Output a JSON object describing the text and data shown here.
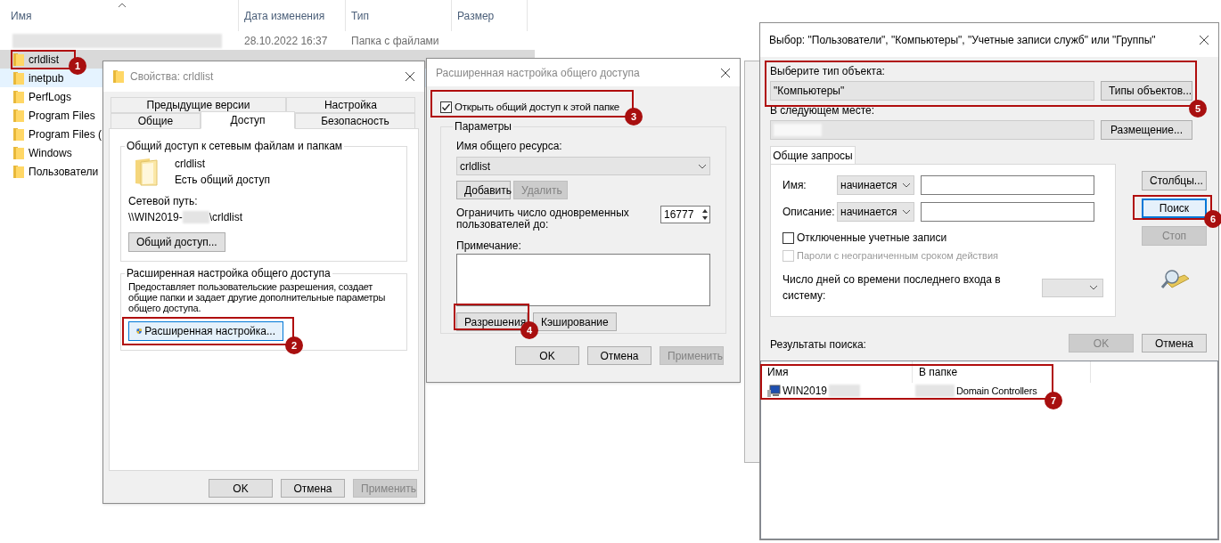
{
  "explorer": {
    "columns": [
      "Имя",
      "Дата изменения",
      "Тип",
      "Размер"
    ],
    "rows": [
      {
        "date": "28.10.2022 16:37",
        "type": "Папка с файлами",
        "selected": false
      },
      {
        "name": "crldlist",
        "selected": true
      },
      {
        "name": "inetpub",
        "selected": false,
        "hovered": true
      },
      {
        "name": "PerfLogs",
        "selected": false
      },
      {
        "name": "Program Files",
        "selected": false
      },
      {
        "name": "Program Files (",
        "selected": false
      },
      {
        "name": "Windows",
        "selected": false
      },
      {
        "name": "Пользователи",
        "selected": false
      }
    ]
  },
  "properties_dialog": {
    "title": "Свойства: crldlist",
    "tab_rows": [
      [
        {
          "label": "Предыдущие версии",
          "selected": false
        },
        {
          "label": "Настройка",
          "selected": false
        }
      ],
      [
        {
          "label": "Общие",
          "selected": false
        },
        {
          "label": "Доступ",
          "selected": true
        },
        {
          "label": "Безопасность",
          "selected": false
        }
      ]
    ],
    "network_group": {
      "title": "Общий доступ к сетевым файлам и папкам",
      "folder_name": "crldlist",
      "status": "Есть общий доступ",
      "path_label": "Сетевой путь:",
      "path_start": "\\\\WIN2019-",
      "path_end": "\\crldlist",
      "button": "Общий доступ..."
    },
    "advanced_group": {
      "title": "Расширенная настройка общего доступа",
      "description": "Предоставляет пользовательские разрешения, создает общие папки и задает другие дополнительные параметры общего доступа.",
      "button": "Расширенная настройка..."
    },
    "buttons": [
      {
        "label": "OK",
        "disabled": false
      },
      {
        "label": "Отмена",
        "disabled": false
      },
      {
        "label": "Применить",
        "disabled": true
      }
    ]
  },
  "advanced_dialog": {
    "title": "Расширенная настройка общего доступа",
    "share_checkbox": {
      "label": "Открыть общий доступ к этой папке",
      "checked": true
    },
    "group_title": "Параметры",
    "share_name_label": "Имя общего ресурса:",
    "share_name": "crldlist",
    "name_buttons": [
      {
        "label": "Добавить",
        "disabled": false
      },
      {
        "label": "Удалить",
        "disabled": true
      }
    ],
    "limit_label": "Ограничить число одновременных пользователей до:",
    "limit_value": "16777",
    "note_label": "Примечание:",
    "group_buttons": [
      {
        "label": "Разрешения",
        "disabled": false
      },
      {
        "label": "Кэширование",
        "disabled": false
      }
    ],
    "buttons": [
      {
        "label": "OK",
        "disabled": false
      },
      {
        "label": "Отмена",
        "disabled": false
      },
      {
        "label": "Применить",
        "disabled": true
      }
    ]
  },
  "select_dialog": {
    "title": "Выбор: \"Пользователи\", \"Компьютеры\", \"Учетные записи служб\" или \"Группы\"",
    "object_type_label": "Выберите тип объекта:",
    "object_type": "\"Компьютеры\"",
    "object_type_button": "Типы объектов...",
    "location_label": "В следующем месте:",
    "location_button": "Размещение...",
    "tab": {
      "label": "Общие запросы",
      "selected": true
    },
    "queries": [
      {
        "label": "Имя:",
        "operator": "начинается"
      },
      {
        "label": "Описание:",
        "operator": "начинается"
      }
    ],
    "checkboxes": [
      {
        "label": "Отключенные учетные записи",
        "checked": false,
        "disabled": false
      },
      {
        "label": "Пароли с неограниченным сроком действия",
        "checked": false,
        "disabled": true
      }
    ],
    "days_label": "Число дней со времени последнего входа в систему:",
    "side_buttons": [
      {
        "label": "Столбцы...",
        "disabled": false,
        "focused": false
      },
      {
        "label": "Поиск",
        "disabled": false,
        "focused": true
      },
      {
        "label": "Стоп",
        "disabled": true,
        "focused": false
      }
    ],
    "buttons": [
      {
        "label": "OK",
        "disabled": true
      },
      {
        "label": "Отмена",
        "disabled": false
      }
    ],
    "results_label": "Результаты поиска:",
    "results": {
      "columns": [
        "Имя",
        "В папке"
      ],
      "rows": [
        {
          "name": "WIN2019",
          "folder": "Domain Controllers"
        }
      ]
    }
  },
  "callouts": [
    {
      "number": "1"
    },
    {
      "number": "2"
    },
    {
      "number": "3"
    },
    {
      "number": "4"
    },
    {
      "number": "5"
    },
    {
      "number": "6"
    },
    {
      "number": "7"
    }
  ]
}
